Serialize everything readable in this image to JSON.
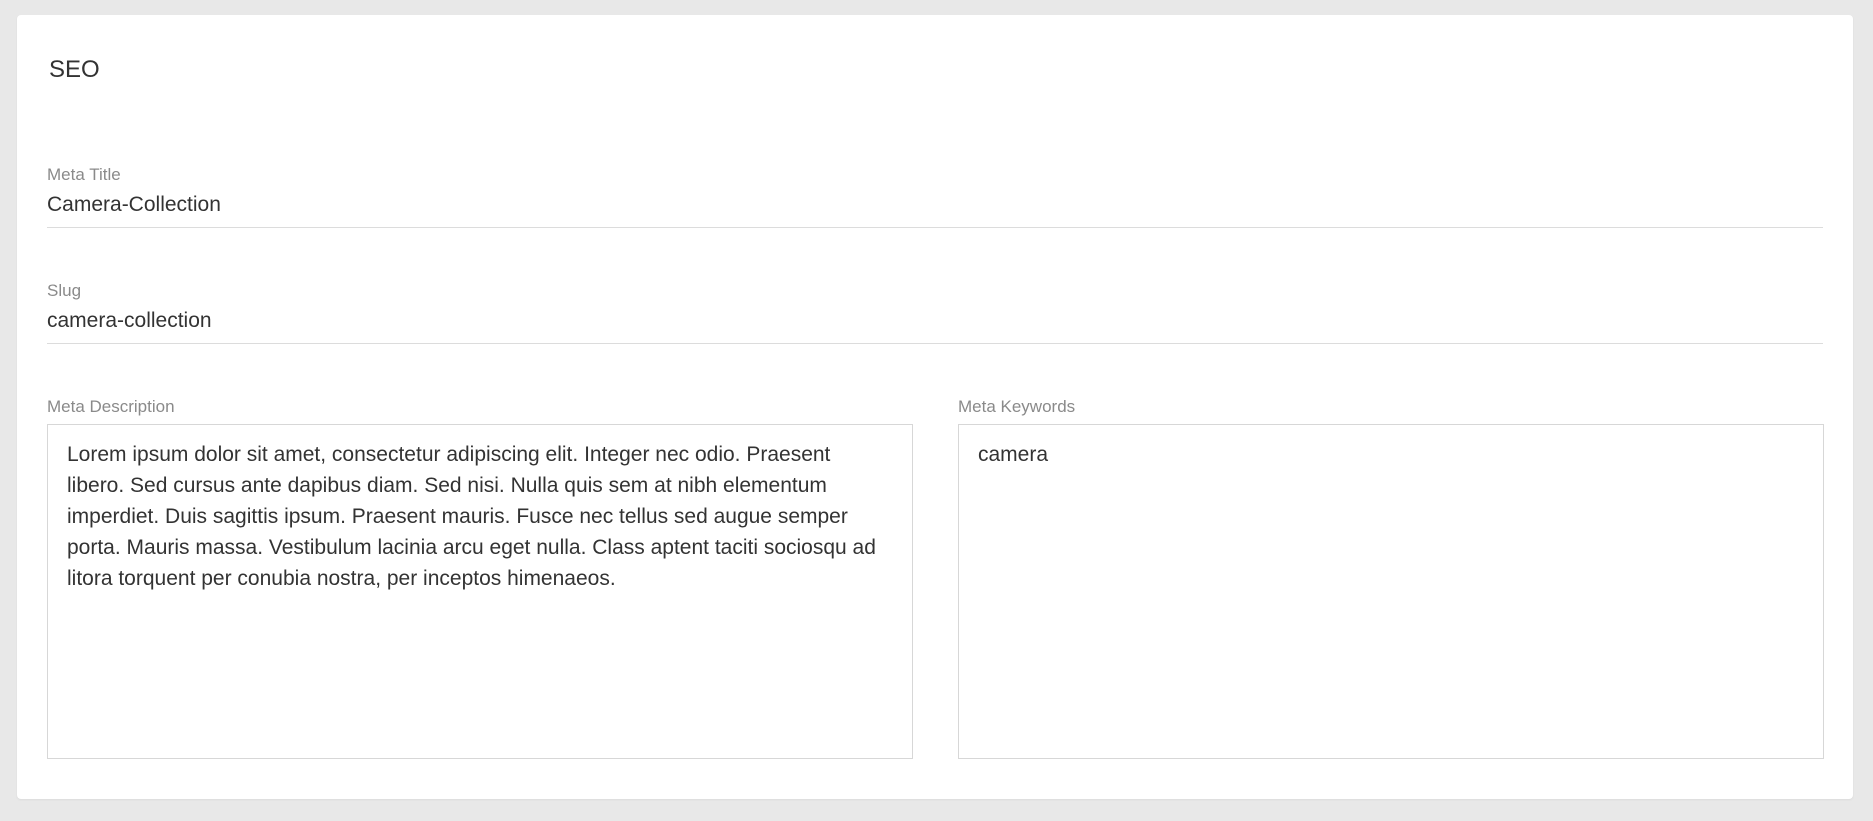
{
  "section": {
    "title": "SEO"
  },
  "fields": {
    "meta_title": {
      "label": "Meta Title",
      "value": "Camera-Collection"
    },
    "slug": {
      "label": "Slug",
      "value": "camera-collection"
    },
    "meta_description": {
      "label": "Meta Description",
      "value": "Lorem ipsum dolor sit amet, consectetur adipiscing elit. Integer nec odio. Praesent libero. Sed cursus ante dapibus diam. Sed nisi. Nulla quis sem at nibh elementum imperdiet. Duis sagittis ipsum. Praesent mauris. Fusce nec tellus sed augue semper porta. Mauris massa. Vestibulum lacinia arcu eget nulla. Class aptent taciti sociosqu ad litora torquent per conubia nostra, per inceptos himenaeos."
    },
    "meta_keywords": {
      "label": "Meta Keywords",
      "value": "camera"
    }
  }
}
